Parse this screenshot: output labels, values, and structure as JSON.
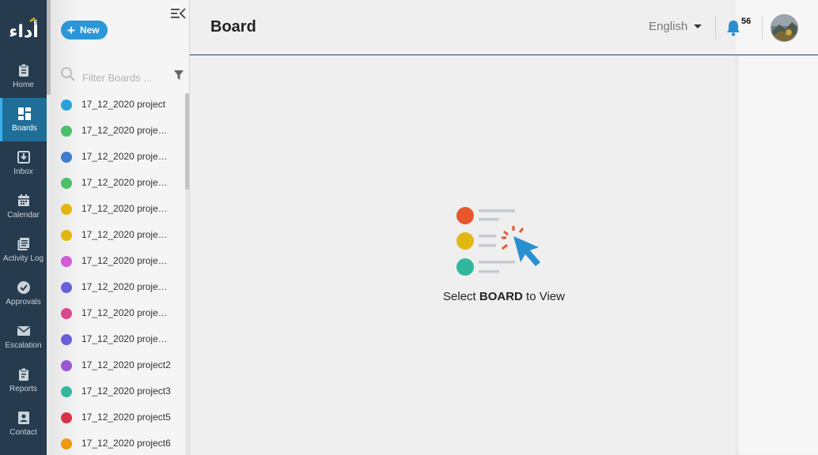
{
  "app": {
    "logo_text": "أداء"
  },
  "nav": {
    "items": [
      {
        "label": "Home",
        "icon": "clipboard-icon"
      },
      {
        "label": "Boards",
        "icon": "grid-icon",
        "active": true
      },
      {
        "label": "Inbox",
        "icon": "inbox-icon"
      },
      {
        "label": "Calendar",
        "icon": "calendar-icon"
      },
      {
        "label": "Activity Log",
        "icon": "activity-log-icon"
      },
      {
        "label": "Approvals",
        "icon": "check-circle-icon"
      },
      {
        "label": "Escalation",
        "icon": "mail-icon"
      },
      {
        "label": "Reports",
        "icon": "report-icon"
      },
      {
        "label": "Contact",
        "icon": "contact-icon"
      }
    ]
  },
  "boards_panel": {
    "new_label": "New",
    "filter_placeholder": "Filter Boards ...",
    "boards": [
      {
        "name": "17_12_2020 project",
        "color": "#2aa1dc"
      },
      {
        "name": "17_12_2020 project...",
        "color": "#4cbf6b"
      },
      {
        "name": "17_12_2020 project...",
        "color": "#3e7bd1"
      },
      {
        "name": "17_12_2020 project...",
        "color": "#4cbf6b"
      },
      {
        "name": "17_12_2020 project...",
        "color": "#e2b714"
      },
      {
        "name": "17_12_2020 project...",
        "color": "#e2b714"
      },
      {
        "name": "17_12_2020 project...",
        "color": "#d45ad8"
      },
      {
        "name": "17_12_2020 project...",
        "color": "#6a5fd9"
      },
      {
        "name": "17_12_2020 project...",
        "color": "#d84a8c"
      },
      {
        "name": "17_12_2020 project...",
        "color": "#6a5fd9"
      },
      {
        "name": "17_12_2020 project2",
        "color": "#9b56d2"
      },
      {
        "name": "17_12_2020 project3",
        "color": "#31b89c"
      },
      {
        "name": "17_12_2020 project5",
        "color": "#d93346"
      },
      {
        "name": "17_12_2020 project6",
        "color": "#ef9812"
      }
    ]
  },
  "header": {
    "title": "Board",
    "language": "English",
    "notification_count": "56"
  },
  "empty_state": {
    "prefix": "Select ",
    "emphasis": "BOARD",
    "suffix": " to View"
  },
  "colors": {
    "rail": "#263b4d",
    "rail_active": "#1f6e98",
    "accent": "#2b97d9"
  }
}
